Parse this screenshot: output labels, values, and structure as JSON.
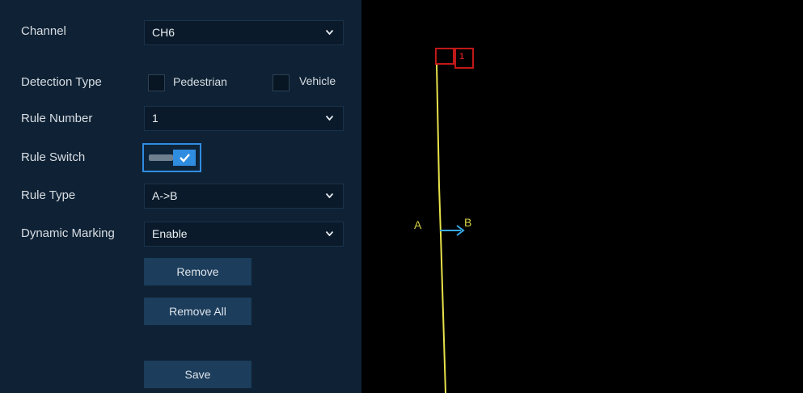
{
  "form": {
    "channel": {
      "label": "Channel",
      "value": "CH6"
    },
    "detection_type": {
      "label": "Detection Type",
      "options": [
        {
          "label": "Pedestrian",
          "checked": false
        },
        {
          "label": "Vehicle",
          "checked": false
        }
      ]
    },
    "rule_number": {
      "label": "Rule Number",
      "value": "1"
    },
    "rule_switch": {
      "label": "Rule Switch",
      "on": true
    },
    "rule_type": {
      "label": "Rule Type",
      "value": "A->B"
    },
    "dynamic_marking": {
      "label": "Dynamic Marking",
      "value": "Enable"
    },
    "buttons": {
      "remove": "Remove",
      "remove_all": "Remove All",
      "save": "Save"
    }
  },
  "canvas": {
    "rule_index": "1",
    "point_a": "A",
    "point_b": "B",
    "line_color": "#e8e24a",
    "arrow_color": "#37a8e6",
    "marker_color": "#c01818"
  },
  "colors": {
    "panel_bg": "#0f2235",
    "input_bg": "#0a1a2a",
    "button_bg": "#1c3d5c",
    "accent": "#2f8de0"
  }
}
